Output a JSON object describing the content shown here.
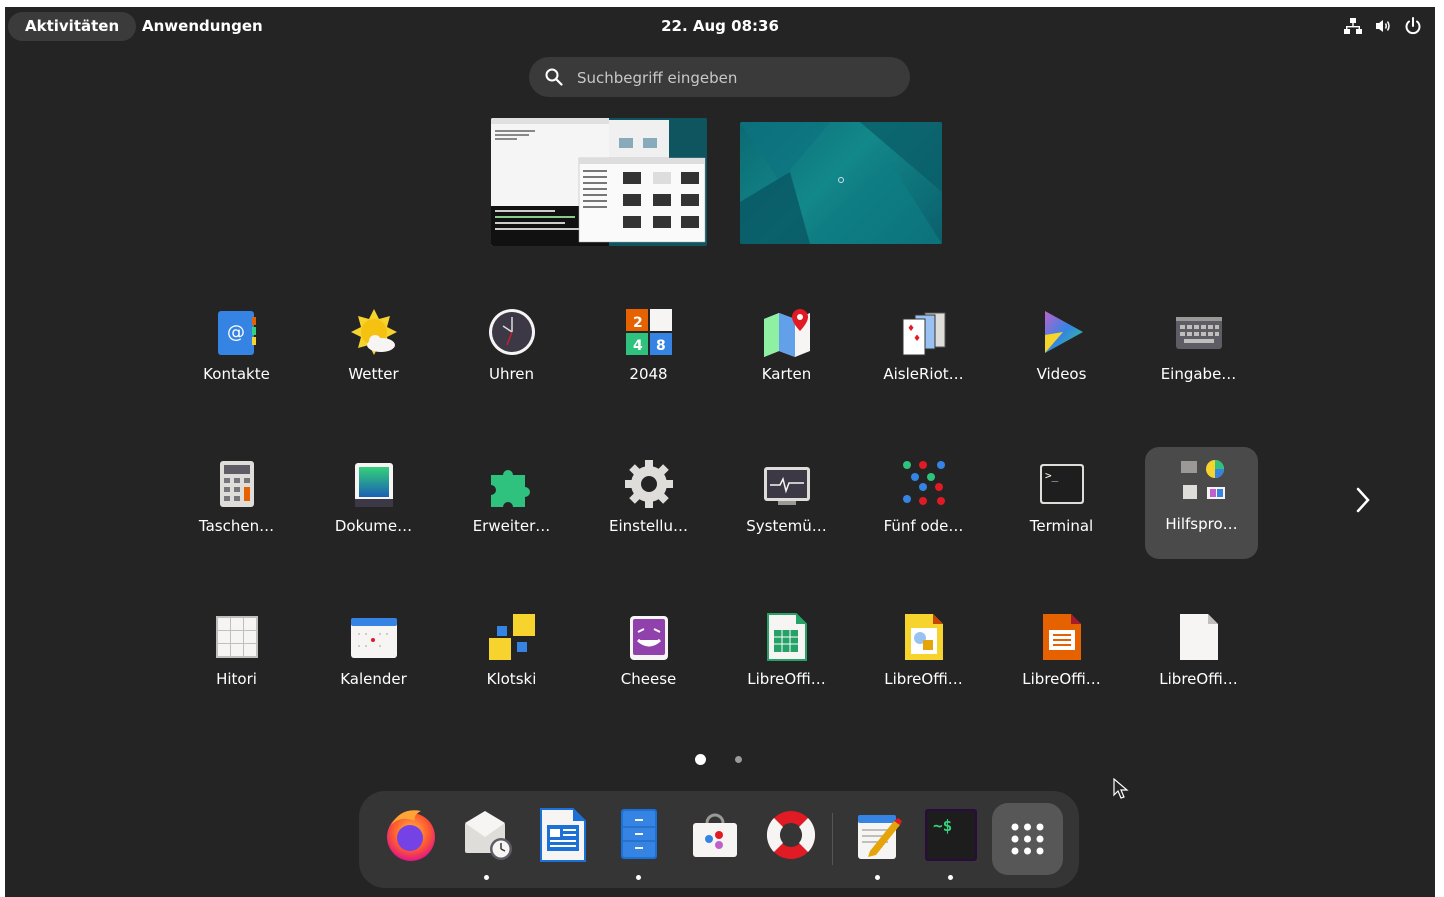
{
  "topbar": {
    "activities_label": "Aktivitäten",
    "applications_label": "Anwendungen",
    "clock": "22. Aug  08:36",
    "tray_icons": [
      "network-icon",
      "volume-icon",
      "power-icon"
    ]
  },
  "search": {
    "placeholder": "Suchbegriff eingeben",
    "value": ""
  },
  "workspaces": [
    "workspace-1",
    "workspace-2"
  ],
  "app_grid": {
    "rows": [
      [
        {
          "label": "Kontakte",
          "icon": "contacts-icon"
        },
        {
          "label": "Wetter",
          "icon": "weather-icon"
        },
        {
          "label": "Uhren",
          "icon": "clocks-icon"
        },
        {
          "label": "2048",
          "icon": "game-2048-icon"
        },
        {
          "label": "Karten",
          "icon": "maps-icon"
        },
        {
          "label": "AisleRiot…",
          "icon": "cards-icon"
        },
        {
          "label": "Videos",
          "icon": "videos-icon"
        },
        {
          "label": "Eingabe…",
          "icon": "keyboard-icon"
        }
      ],
      [
        {
          "label": "Taschen…",
          "icon": "calculator-icon"
        },
        {
          "label": "Dokume…",
          "icon": "document-scanner-icon"
        },
        {
          "label": "Erweiter…",
          "icon": "extensions-icon"
        },
        {
          "label": "Einstellu…",
          "icon": "settings-icon"
        },
        {
          "label": "Systemü…",
          "icon": "system-monitor-icon"
        },
        {
          "label": "Fünf ode…",
          "icon": "five-or-more-icon"
        },
        {
          "label": "Terminal",
          "icon": "terminal-icon"
        },
        {
          "label": "Hilfspro…",
          "icon": "utilities-folder-icon",
          "selected": true
        }
      ],
      [
        {
          "label": "Hitori",
          "icon": "hitori-icon"
        },
        {
          "label": "Kalender",
          "icon": "calendar-icon"
        },
        {
          "label": "Klotski",
          "icon": "klotski-icon"
        },
        {
          "label": "Cheese",
          "icon": "cheese-icon"
        },
        {
          "label": "LibreOffi…",
          "icon": "libreoffice-calc-icon"
        },
        {
          "label": "LibreOffi…",
          "icon": "libreoffice-draw-icon"
        },
        {
          "label": "LibreOffi…",
          "icon": "libreoffice-impress-icon"
        },
        {
          "label": "LibreOffi…",
          "icon": "libreoffice-icon"
        }
      ]
    ],
    "page_current": 1,
    "page_count": 2
  },
  "dock": [
    {
      "name": "firefox",
      "icon": "firefox-icon",
      "running": false
    },
    {
      "name": "evolution",
      "icon": "mail-clock-icon",
      "running": true
    },
    {
      "name": "libreoffice-writer",
      "icon": "libreoffice-writer-icon",
      "running": false
    },
    {
      "name": "files",
      "icon": "files-icon",
      "running": true
    },
    {
      "name": "software",
      "icon": "software-store-icon",
      "running": false
    },
    {
      "name": "help",
      "icon": "help-lifebuoy-icon",
      "running": false
    },
    {
      "name": "text-editor",
      "icon": "text-editor-icon",
      "running": true
    },
    {
      "name": "terminal",
      "icon": "terminal-dock-icon",
      "running": true
    },
    {
      "name": "show-apps",
      "icon": "app-grid-icon",
      "running": false
    }
  ]
}
